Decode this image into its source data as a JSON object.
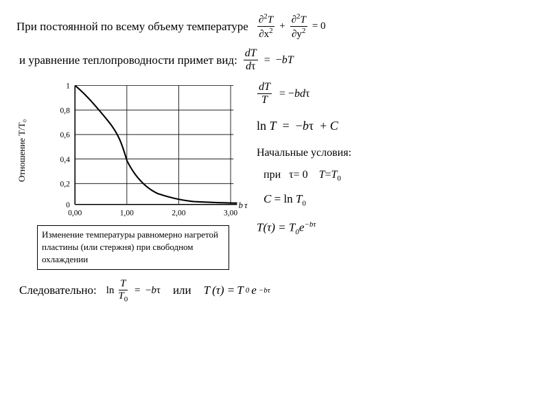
{
  "top": {
    "text": "При постоянной по  всему  объему  температуре",
    "formula_eq": "= 0"
  },
  "second": {
    "text": "и уравнение теплопроводности примет  вид:"
  },
  "chart": {
    "ylabel": "Отношение T/T₀",
    "xlabel": "b τ",
    "caption": "Изменение  температуры равномерно нагретой пластины (или  стержня) при свободном  охлаждении",
    "yticks": [
      "1",
      "0,8",
      "0,6",
      "0,4",
      "0,2",
      "0"
    ],
    "xticks": [
      "0,00",
      "1,00",
      "2,00",
      "3,00"
    ]
  },
  "right_formulas": {
    "f1_label": "dT/dτ = −bT",
    "f2_label": "dT/T = −bd τ",
    "f3_label": "ln T = −b τ + C",
    "nachalnie": "Начальные  условия:",
    "pri": "при   τ= 0   T=T",
    "sub0": "0",
    "f4_label": "C = ln T₀"
  },
  "bottom": {
    "sledovatelno": "Следовательно:",
    "ili": "или"
  }
}
